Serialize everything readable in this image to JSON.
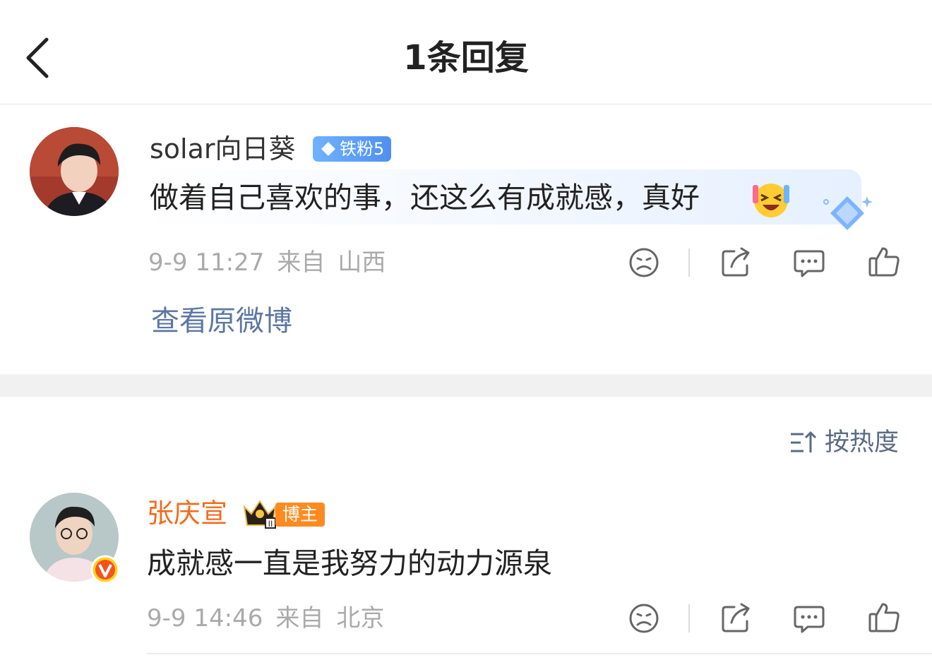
{
  "header": {
    "title": "1条回复",
    "back_icon": "chevron-left-icon"
  },
  "root_comment": {
    "username": "solar向日葵",
    "fan_badge": "铁粉5",
    "text": "做着自己喜欢的事，还这么有成就感，真好",
    "emoji": "laughing-emoji",
    "time": "9-9 11:27",
    "from_label": "来自",
    "location": "山西",
    "view_original": "查看原微博"
  },
  "sort": {
    "label": "按热度",
    "icon": "sort-icon"
  },
  "reply": {
    "username": "张庆宣",
    "username_color": "#f26b1d",
    "role_badge": "博主",
    "text": "成就感一直是我努力的动力源泉",
    "time": "9-9 14:46",
    "from_label": "来自",
    "location": "北京"
  },
  "colors": {
    "link": "#5b77a3",
    "meta": "#aaaaaa",
    "badge_blue": "#4f8ff0",
    "badge_orange": "#ff8a1f"
  }
}
